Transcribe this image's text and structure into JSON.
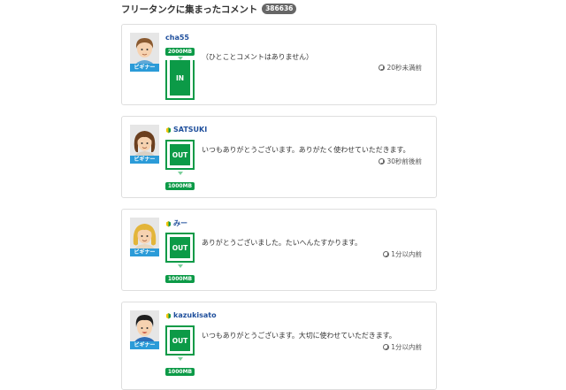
{
  "header": {
    "title": "フリータンクに集まったコメント",
    "count": "386636"
  },
  "comments": [
    {
      "username": "cha55",
      "rank": "ビギナー",
      "beginner_mark": false,
      "type": "IN",
      "amount": "2000MB",
      "text": "（ひとことコメントはありません）",
      "time": "20秒未満前"
    },
    {
      "username": "SATSUKI",
      "rank": "ビギナー",
      "beginner_mark": true,
      "type": "OUT",
      "amount": "1000MB",
      "text": "いつもありがとうございます。ありがたく使わせていただきます。",
      "time": "30秒前後前"
    },
    {
      "username": "みー",
      "rank": "ビギナー",
      "beginner_mark": true,
      "type": "OUT",
      "amount": "1000MB",
      "text": "ありがとうございました。たいへんたすかります。",
      "time": "1分以内前"
    },
    {
      "username": "kazukisato",
      "rank": "ビギナー",
      "beginner_mark": true,
      "type": "OUT",
      "amount": "1000MB",
      "text": "いつもありがとうございます。大切に使わせていただきます。",
      "time": "1分以内前"
    }
  ],
  "colors": {
    "tank_green": "#0c9a47",
    "rank_blue": "#2b9bd8",
    "username_blue": "#1f4f9c"
  },
  "icons": {
    "time": "clock-icon",
    "beginner": "beginner-leaf-icon"
  }
}
